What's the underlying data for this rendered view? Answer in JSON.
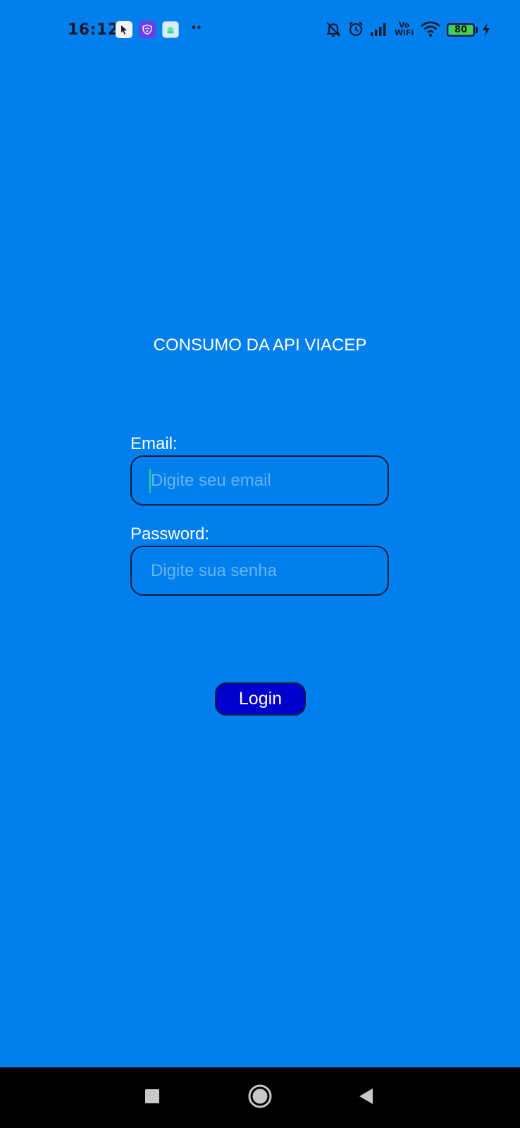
{
  "status_bar": {
    "time": "16:12",
    "notification_icons": [
      "cursor-app-icon",
      "shield-wifi-app-icon",
      "android-app-icon"
    ],
    "more_indicator": "••",
    "system_icons": [
      "notifications-off-icon",
      "alarm-icon",
      "cell-signal-icon",
      "volte-wifi-icon",
      "wifi-icon",
      "battery-icon",
      "charging-icon"
    ],
    "volte_top": "Vo",
    "volte_bottom": "WiFi",
    "battery_level": "80"
  },
  "main": {
    "title": "CONSUMO DA API VIACEP",
    "email_label": "Email:",
    "email_placeholder": "Digite seu email",
    "email_value": "",
    "password_label": "Password:",
    "password_placeholder": "Digite sua senha",
    "password_value": "",
    "login_label": "Login"
  },
  "nav_bar": {
    "buttons": [
      "recents-icon",
      "home-icon",
      "back-icon"
    ]
  },
  "colors": {
    "background": "#007fed",
    "button": "#0000cd",
    "border": "#0b1d3d",
    "placeholder": "#69b4f2",
    "text": "#ffffff"
  }
}
